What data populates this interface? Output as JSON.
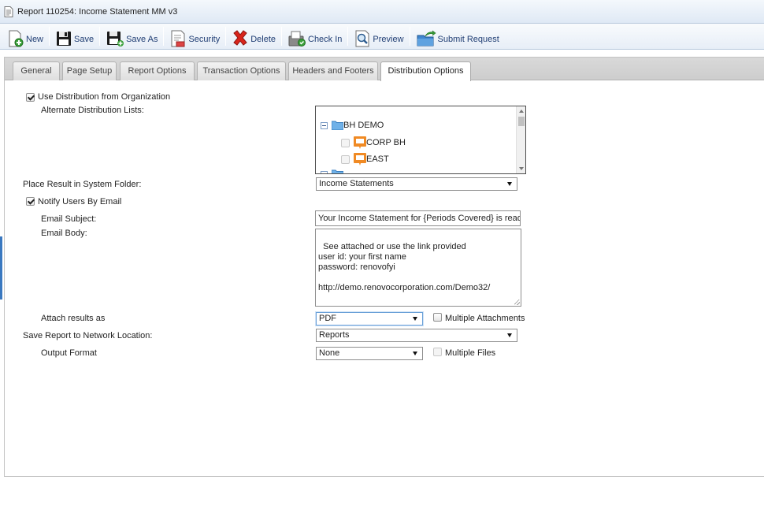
{
  "window": {
    "title": "Report 110254: Income Statement MM v3"
  },
  "toolbar": {
    "new_label": "New",
    "save_label": "Save",
    "save_as_label": "Save As",
    "security_label": "Security",
    "delete_label": "Delete",
    "check_in_label": "Check In",
    "preview_label": "Preview",
    "submit_label": "Submit Request"
  },
  "tabs": [
    {
      "label": "General"
    },
    {
      "label": "Page Setup"
    },
    {
      "label": "Report Options"
    },
    {
      "label": "Transaction Options"
    },
    {
      "label": "Headers and Footers"
    },
    {
      "label": "Distribution Options",
      "active": true
    }
  ],
  "form": {
    "use_distribution": {
      "label": "Use Distribution from Organization",
      "checked": true
    },
    "alt_lists_label": "Alternate Distribution Lists:",
    "tree": {
      "root": {
        "label": "BH DEMO",
        "expanded": true
      },
      "children": [
        {
          "label": "CORP BH"
        },
        {
          "label": "EAST"
        }
      ]
    },
    "system_folder": {
      "label": "Place Result in System Folder:",
      "value": "Income Statements"
    },
    "notify_email": {
      "label": "Notify Users By Email",
      "checked": true
    },
    "email_subject": {
      "label": "Email Subject:",
      "value": "Your Income Statement for {Periods Covered} is ready"
    },
    "email_body": {
      "label": "Email Body:",
      "value": "See attached or use the link provided\nuser id: your first name\npassword: renovofyi\n\nhttp://demo.renovocorporation.com/Demo32/"
    },
    "attach_as": {
      "label": "Attach results as",
      "value": "PDF",
      "multiple_label": "Multiple Attachments"
    },
    "network_location": {
      "label": "Save Report to Network Location:",
      "value": "Reports"
    },
    "output_format": {
      "label": "Output Format",
      "value": "None",
      "multiple_label": "Multiple Files"
    }
  },
  "colors": {
    "toolbar_text": "#1f3d73",
    "accent": "#3a78c0",
    "delete_red": "#d9241b"
  }
}
